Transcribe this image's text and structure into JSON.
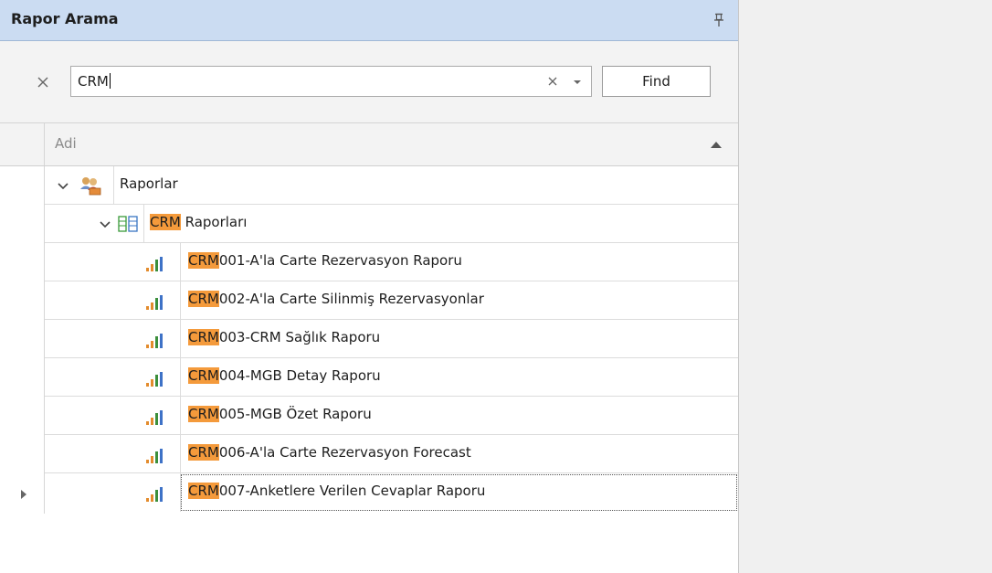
{
  "panel": {
    "title": "Rapor Arama",
    "pin_icon": "pin-icon"
  },
  "search": {
    "close_icon": "close-icon",
    "value": "CRM",
    "clear_icon": "clear-icon",
    "dropdown_icon": "chevron-down-icon",
    "find_label": "Find"
  },
  "grid": {
    "column_header": "Adi",
    "sort": "ascending",
    "highlight_color": "#f49a3b",
    "root": {
      "label": "Raporlar",
      "icon": "users-folder-icon",
      "expanded": true
    },
    "group": {
      "highlight": "CRM",
      "rest": " Raporları",
      "icon": "report-group-icon",
      "expanded": true
    },
    "reports": [
      {
        "highlight": "CRM",
        "rest": "001-A'la Carte Rezervasyon Raporu",
        "icon": "bar-chart-icon"
      },
      {
        "highlight": "CRM",
        "rest": "002-A'la Carte Silinmiş Rezervasyonlar",
        "icon": "bar-chart-icon"
      },
      {
        "highlight": "CRM",
        "rest": "003-CRM Sağlık Raporu",
        "icon": "bar-chart-icon"
      },
      {
        "highlight": "CRM",
        "rest": "004-MGB Detay Raporu",
        "icon": "bar-chart-icon"
      },
      {
        "highlight": "CRM",
        "rest": "005-MGB Özet Raporu",
        "icon": "bar-chart-icon"
      },
      {
        "highlight": "CRM",
        "rest": "006-A'la Carte Rezervasyon Forecast",
        "icon": "bar-chart-icon"
      },
      {
        "highlight": "CRM",
        "rest": "007-Anketlere Verilen Cevaplar Raporu",
        "icon": "bar-chart-icon"
      }
    ]
  }
}
